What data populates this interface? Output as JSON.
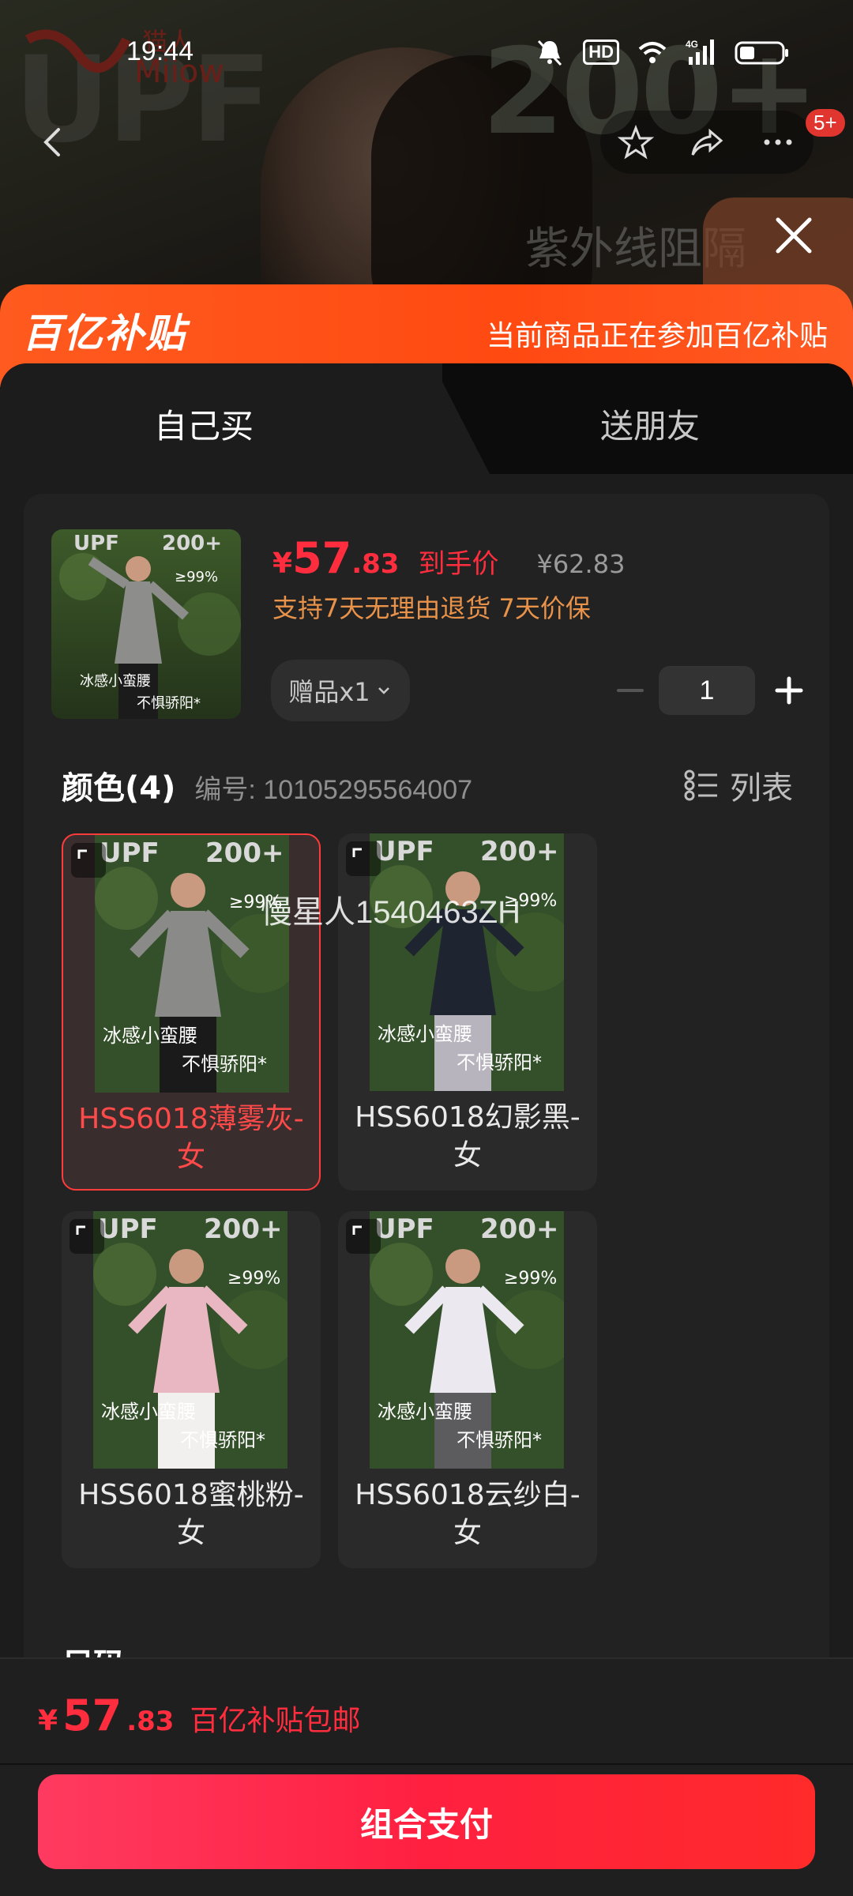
{
  "status": {
    "time": "19:44",
    "hd": "HD",
    "network": "4G"
  },
  "background": {
    "upf_text": "UPF",
    "count_text": "200+",
    "uv_text": "紫外线阻隔",
    "logo_cn": "猫人",
    "logo_en": "Miiow",
    "nav_badge": "5+"
  },
  "banner": {
    "logo": "百亿补贴",
    "text": "当前商品正在参加百亿补贴"
  },
  "tabs": [
    {
      "label": "自己买",
      "active": true
    },
    {
      "label": "送朋友",
      "active": false
    }
  ],
  "product": {
    "price_symbol": "¥",
    "price_int": "57",
    "price_dec": ".83",
    "price_label": "到手价",
    "original_price": "¥62.83",
    "service": "支持7天无理由退货 7天价保",
    "gift": "赠品x1",
    "quantity": "1",
    "thumb": {
      "line1": "冰感小蛮腰",
      "line2": "不惧骄阳*",
      "upf": "UPF",
      "count": "200+",
      "rate": "≥99%"
    }
  },
  "color_section": {
    "title": "颜色(4)",
    "code": "编号: 10105295564007",
    "view_toggle": "列表"
  },
  "options": [
    {
      "label": "HSS6018薄雾灰-女",
      "selected": true,
      "caption1": "冰感小蛮腰",
      "caption2": "不惧骄阳*",
      "top_color": "#8a8a88",
      "bottom_color": "#1a1a1a"
    },
    {
      "label": "HSS6018幻影黑-女",
      "selected": false,
      "caption1": "冰感小蛮腰",
      "caption2": "不惧骄阳*",
      "top_color": "#1e2430",
      "bottom_color": "#b8b4bd"
    },
    {
      "label": "HSS6018蜜桃粉-女",
      "selected": false,
      "caption1": "冰感小蛮腰",
      "caption2": "不惧骄阳*",
      "top_color": "#e9b7c2",
      "bottom_color": "#f2f0ee"
    },
    {
      "label": "HSS6018云纱白-女",
      "selected": false,
      "caption1": "冰感小蛮腰",
      "caption2": "不惧骄阳*",
      "top_color": "#ebe8ef",
      "bottom_color": "#5c5c5f"
    }
  ],
  "watermark": "慢星人1540463ZH",
  "size_section": {
    "title": "尺码"
  },
  "bottom": {
    "price_symbol": "¥",
    "price_int": "57",
    "price_dec": ".83",
    "note": "百亿补贴包邮",
    "pay_label": "组合支付"
  },
  "colors": {
    "accent": "#ff2d3d",
    "banner": "#ff5a1f",
    "service": "#e8924a"
  }
}
